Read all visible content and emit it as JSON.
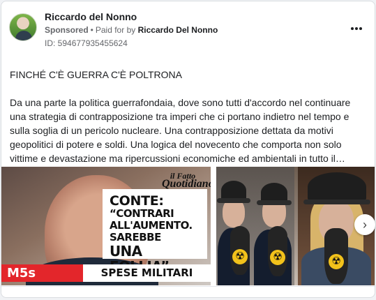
{
  "post": {
    "author": "Riccardo del Nonno",
    "sponsored": "Sponsored",
    "paid_for": "Paid for by",
    "payer": "Riccardo Del Nonno",
    "ad_id": "ID: 594677935455624",
    "headline": "FINCHÉ C'È GUERRA C'È POLTRONA",
    "body": "Da una parte la politica guerrafondaia, dove sono tutti d'accordo nel continuare una strategia di contrapposizione tra imperi che ci portano indietro nel tempo e sulla soglia di un pericolo nucleare. Una contrapposizione dettata da motivi geopolitici di potere e soldi. Una logica del novecento che comporta non solo vittime e devastazione ma ripercussioni economiche ed ambientali in tutto il…"
  },
  "icons": {
    "more": "more-options-icon",
    "next": "chevron-right-icon"
  },
  "carousel": {
    "card1": {
      "brand_line1": "il Fatto",
      "brand_line2": "Quotidiano",
      "quote_line1": "CONTE:",
      "quote_line2": "“CONTRARI",
      "quote_line3": "ALL'AUMENTO.",
      "quote_line4": "SAREBBE",
      "quote_line5": "UNA FOLLIA”",
      "party": "M5s",
      "topic": "SPESE MILITARI"
    },
    "card2": {
      "symbol": "☢"
    }
  }
}
